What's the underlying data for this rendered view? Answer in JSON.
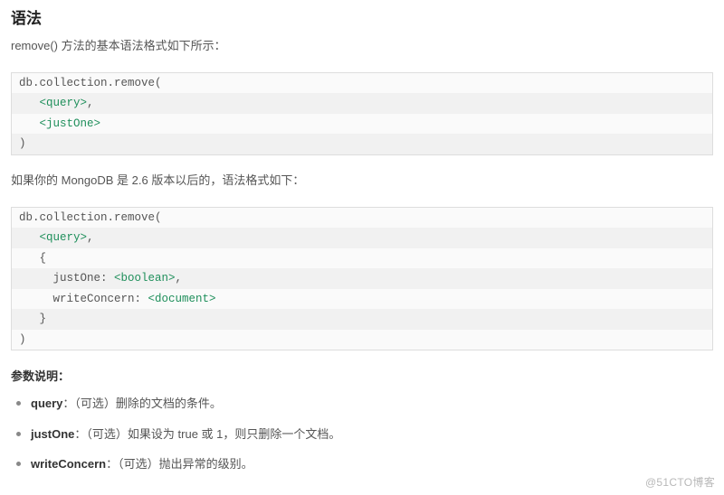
{
  "heading": "语法",
  "intro": "remove() 方法的基本语法格式如下所示：",
  "code1": {
    "l1": "db.collection.remove(",
    "l2_pre": "   ",
    "l2_tag": "<query>",
    "l2_post": ",",
    "l3_pre": "   ",
    "l3_tag": "<justOne>",
    "l4": ")"
  },
  "intro2": "如果你的 MongoDB 是 2.6 版本以后的，语法格式如下：",
  "code2": {
    "l1": "db.collection.remove(",
    "l2_pre": "   ",
    "l2_tag": "<query>",
    "l2_post": ",",
    "l3": "   {",
    "l4_pre": "     justOne: ",
    "l4_tag": "<boolean>",
    "l4_post": ",",
    "l5_pre": "     writeConcern: ",
    "l5_tag": "<document>",
    "l6": "   }",
    "l7": ")"
  },
  "params_heading": "参数说明：",
  "params": [
    {
      "name": "query",
      "desc": "：（可选）删除的文档的条件。"
    },
    {
      "name": "justOne",
      "desc": "：（可选）如果设为 true 或 1，则只删除一个文档。"
    },
    {
      "name": "writeConcern",
      "desc": "：（可选）抛出异常的级别。"
    }
  ],
  "watermark": "@51CTO博客"
}
